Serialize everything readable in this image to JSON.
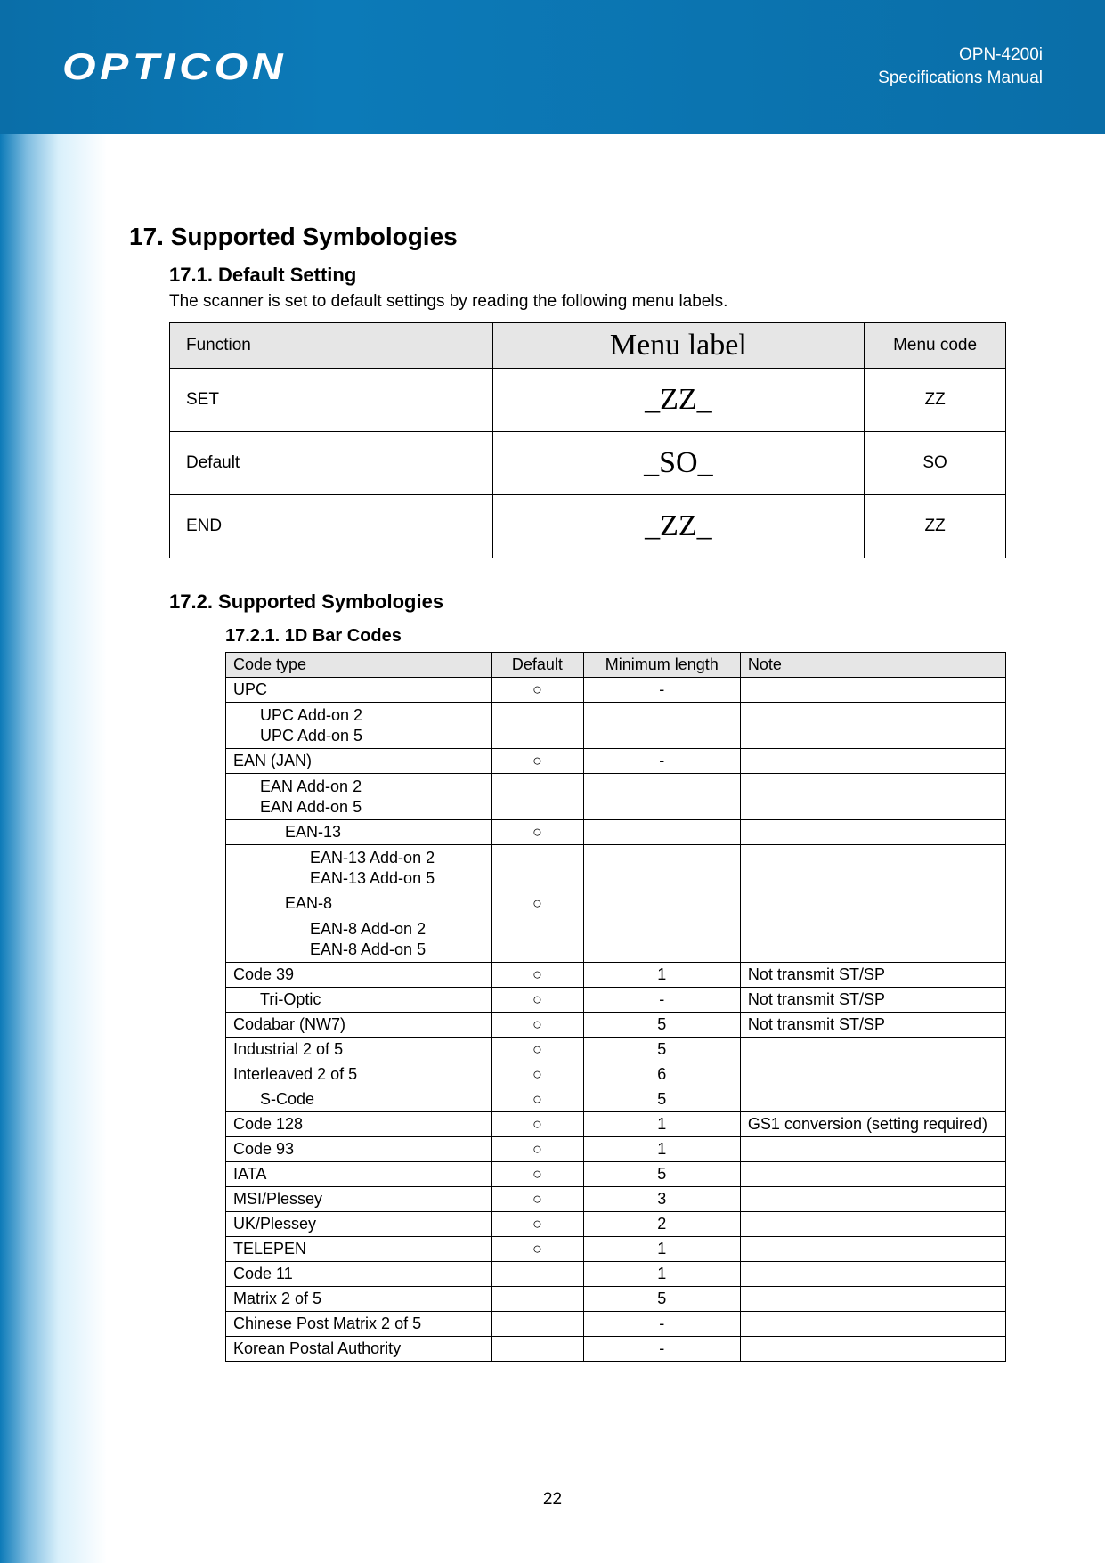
{
  "header": {
    "logo_text": "OPTICON",
    "product": "OPN-4200i",
    "subtitle": "Specifications Manual"
  },
  "section": {
    "title": "17. Supported Symbologies",
    "sub1": {
      "title": "17.1. Default Setting",
      "intro": "The scanner is set to default settings by reading the following menu labels.",
      "table": {
        "headers": {
          "function": "Function",
          "label": "Menu label",
          "code": "Menu code"
        },
        "rows": [
          {
            "function": "SET",
            "label": "_ZZ_",
            "code": "ZZ"
          },
          {
            "function": "Default",
            "label": "_SO_",
            "code": "SO"
          },
          {
            "function": "END",
            "label": "_ZZ_",
            "code": "ZZ"
          }
        ]
      }
    },
    "sub2": {
      "title": "17.2. Supported Symbologies",
      "sub2_1": {
        "title": "17.2.1. 1D Bar Codes",
        "headers": {
          "code_type": "Code type",
          "default": "Default",
          "min_len": "Minimum length",
          "note": "Note"
        },
        "rows": [
          {
            "indent": 0,
            "name": "UPC",
            "default": "○",
            "min": "-",
            "note": ""
          },
          {
            "indent": 1,
            "name": "UPC Add-on 2\nUPC Add-on 5",
            "default": "",
            "min": "",
            "note": ""
          },
          {
            "indent": 0,
            "name": "EAN (JAN)",
            "default": "○",
            "min": "-",
            "note": ""
          },
          {
            "indent": 1,
            "name": "EAN Add-on 2\nEAN Add-on 5",
            "default": "",
            "min": "",
            "note": ""
          },
          {
            "indent": 2,
            "name": "EAN-13",
            "default": "○",
            "min": "",
            "note": ""
          },
          {
            "indent": 3,
            "name": "EAN-13 Add-on 2\nEAN-13 Add-on 5",
            "default": "",
            "min": "",
            "note": ""
          },
          {
            "indent": 2,
            "name": "EAN-8",
            "default": "○",
            "min": "",
            "note": ""
          },
          {
            "indent": 3,
            "name": "EAN-8 Add-on 2\nEAN-8 Add-on 5",
            "default": "",
            "min": "",
            "note": ""
          },
          {
            "indent": 0,
            "name": "Code 39",
            "default": "○",
            "min": "1",
            "note": "Not transmit ST/SP"
          },
          {
            "indent": 1,
            "name": "Tri-Optic",
            "default": "○",
            "min": "-",
            "note": "Not transmit ST/SP"
          },
          {
            "indent": 0,
            "name": "Codabar (NW7)",
            "default": "○",
            "min": "5",
            "note": "Not transmit ST/SP"
          },
          {
            "indent": 0,
            "name": "Industrial 2 of 5",
            "default": "○",
            "min": "5",
            "note": ""
          },
          {
            "indent": 0,
            "name": "Interleaved 2 of 5",
            "default": "○",
            "min": "6",
            "note": ""
          },
          {
            "indent": 1,
            "name": "S-Code",
            "default": "○",
            "min": "5",
            "note": ""
          },
          {
            "indent": 0,
            "name": "Code 128",
            "default": "○",
            "min": "1",
            "note": "GS1 conversion (setting required)"
          },
          {
            "indent": 0,
            "name": "Code 93",
            "default": "○",
            "min": "1",
            "note": ""
          },
          {
            "indent": 0,
            "name": "IATA",
            "default": "○",
            "min": "5",
            "note": ""
          },
          {
            "indent": 0,
            "name": "MSI/Plessey",
            "default": "○",
            "min": "3",
            "note": ""
          },
          {
            "indent": 0,
            "name": "UK/Plessey",
            "default": "○",
            "min": "2",
            "note": ""
          },
          {
            "indent": 0,
            "name": "TELEPEN",
            "default": "○",
            "min": "1",
            "note": ""
          },
          {
            "indent": 0,
            "name": "Code 11",
            "default": "",
            "min": "1",
            "note": ""
          },
          {
            "indent": 0,
            "name": "Matrix 2 of 5",
            "default": "",
            "min": "5",
            "note": ""
          },
          {
            "indent": 0,
            "name": "Chinese Post Matrix 2 of 5",
            "default": "",
            "min": "-",
            "note": ""
          },
          {
            "indent": 0,
            "name": "Korean Postal Authority",
            "default": "",
            "min": "-",
            "note": ""
          }
        ]
      }
    }
  },
  "page_number": "22"
}
